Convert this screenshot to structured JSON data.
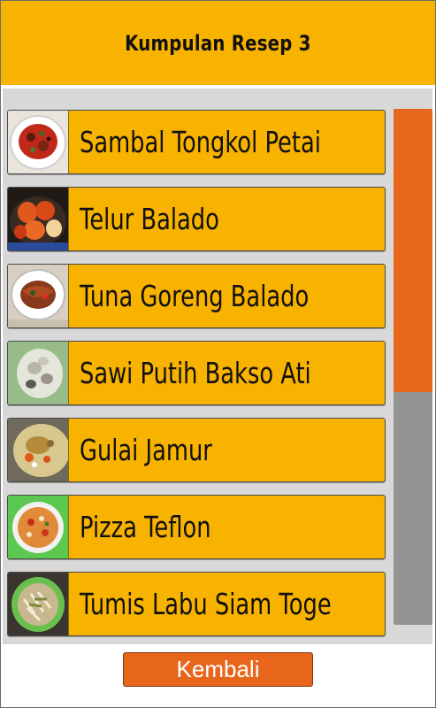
{
  "header": {
    "title": "Kumpulan Resep 3"
  },
  "recipes": [
    {
      "label": "Sambal Tongkol Petai",
      "thumb_icon": "sambal-tongkol-petai-photo-icon"
    },
    {
      "label": "Telur Balado",
      "thumb_icon": "telur-balado-photo-icon"
    },
    {
      "label": "Tuna Goreng Balado",
      "thumb_icon": "tuna-goreng-balado-photo-icon"
    },
    {
      "label": "Sawi Putih Bakso Ati",
      "thumb_icon": "sawi-putih-bakso-ati-photo-icon"
    },
    {
      "label": "Gulai Jamur",
      "thumb_icon": "gulai-jamur-photo-icon"
    },
    {
      "label": "Pizza Teflon",
      "thumb_icon": "pizza-teflon-photo-icon"
    },
    {
      "label": "Tumis Labu Siam Toge",
      "thumb_icon": "tumis-labu-siam-toge-photo-icon"
    }
  ],
  "scrollbar": {
    "position_fraction": 0.0,
    "visible_fraction": 0.55
  },
  "footer": {
    "back_label": "Kembali"
  },
  "colors": {
    "header_bg": "#f8b200",
    "item_bg": "#f8b200",
    "accent_orange": "#e8651c",
    "scroll_track": "#949494",
    "panel_bg": "#d8d8d8"
  }
}
